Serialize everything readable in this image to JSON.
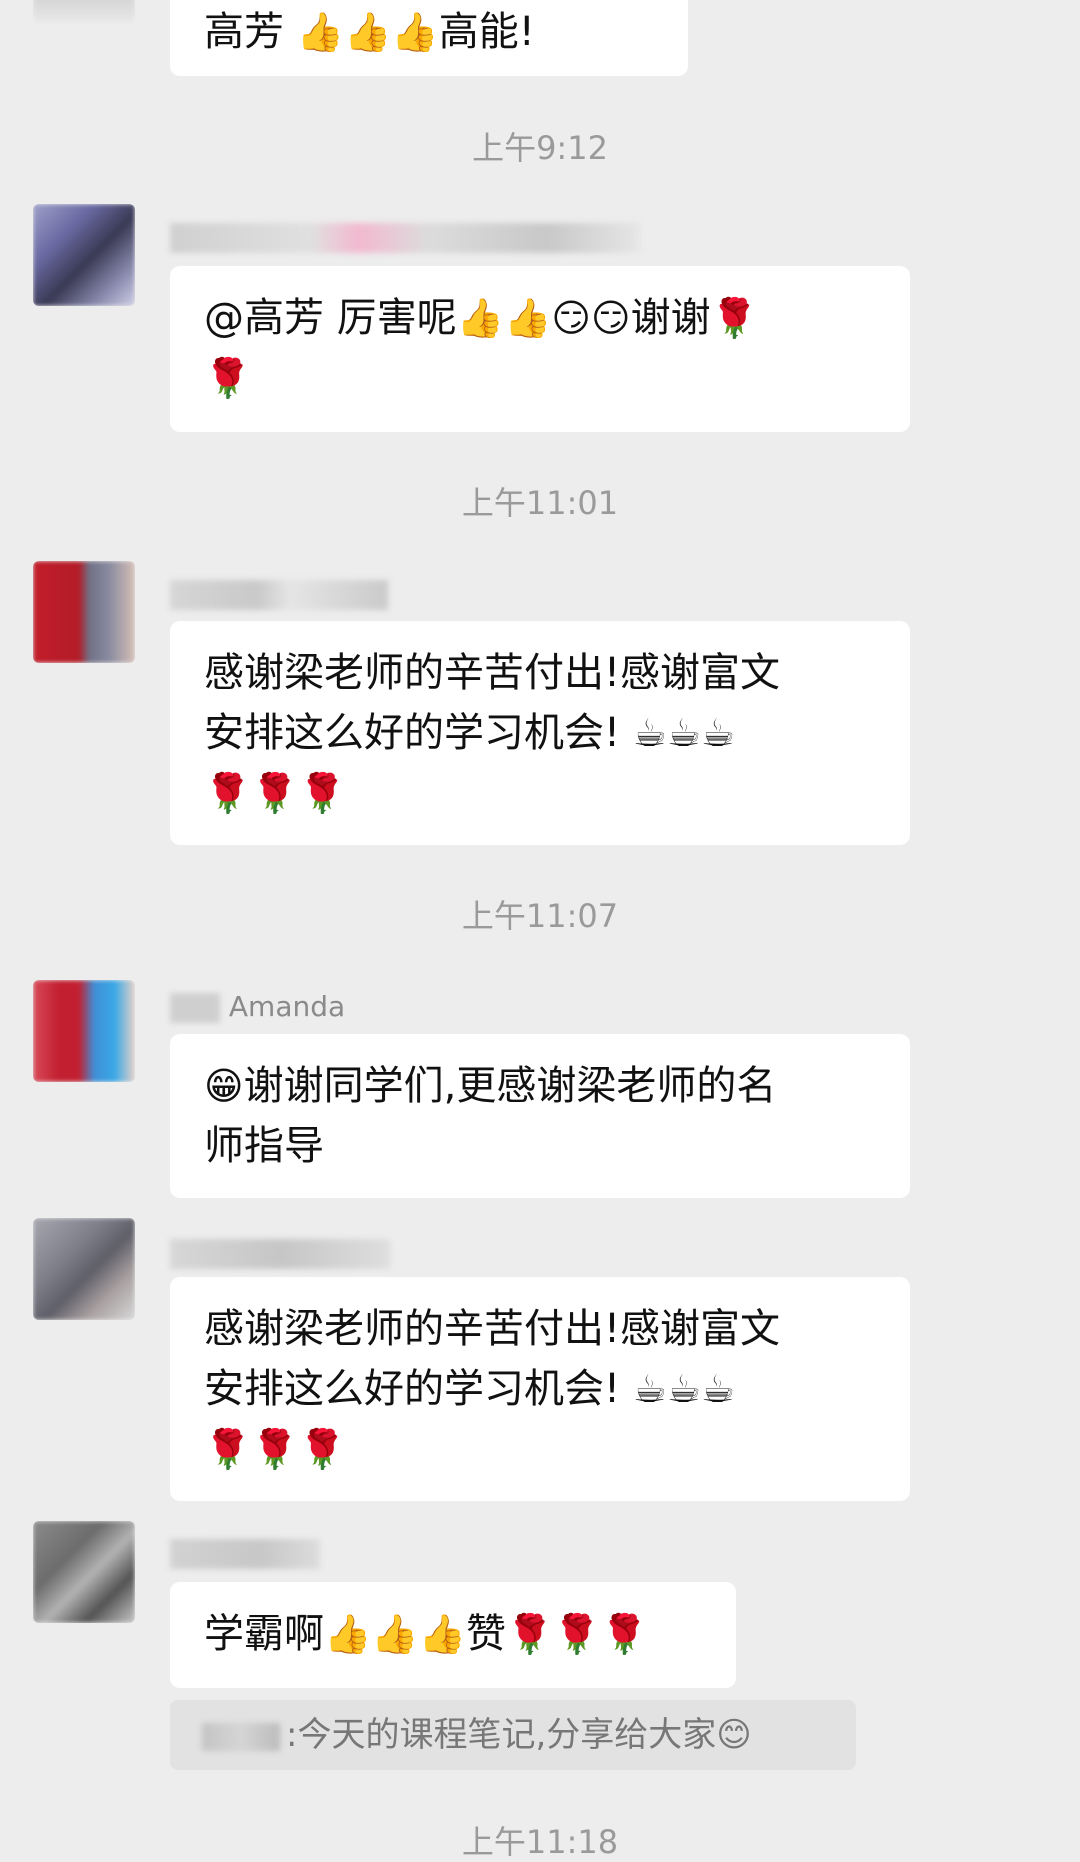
{
  "chat": {
    "messages": [
      {
        "type": "message",
        "name_text": "",
        "lines": [
          [
            {
              "t": "text",
              "v": "高芳 "
            },
            {
              "t": "emoji",
              "v": "👍"
            },
            {
              "t": "emoji",
              "v": "👍"
            },
            {
              "t": "emoji",
              "v": "👍"
            },
            {
              "t": "text",
              "v": "高能!"
            }
          ]
        ]
      },
      {
        "type": "time",
        "text": "上午9:12"
      },
      {
        "type": "message",
        "name_text": "",
        "lines": [
          [
            {
              "t": "text",
              "v": "@高芳 厉害呢"
            },
            {
              "t": "emoji",
              "v": "👍"
            },
            {
              "t": "emoji",
              "v": "👍"
            },
            {
              "t": "emoji",
              "v": "😏"
            },
            {
              "t": "emoji",
              "v": "😏"
            },
            {
              "t": "text",
              "v": "谢谢"
            },
            {
              "t": "emoji",
              "v": "🌹"
            }
          ],
          [
            {
              "t": "emoji",
              "v": "🌹"
            }
          ]
        ]
      },
      {
        "type": "time",
        "text": "上午11:01"
      },
      {
        "type": "message",
        "name_text": "",
        "lines": [
          [
            {
              "t": "text",
              "v": "感谢梁老师的辛苦付出!感谢富文"
            }
          ],
          [
            {
              "t": "text",
              "v": "安排这么好的学习机会! "
            },
            {
              "t": "emoji",
              "v": "☕"
            },
            {
              "t": "emoji",
              "v": "☕"
            },
            {
              "t": "emoji",
              "v": "☕"
            }
          ],
          [
            {
              "t": "emoji",
              "v": "🌹"
            },
            {
              "t": "emoji",
              "v": "🌹"
            },
            {
              "t": "emoji",
              "v": "🌹"
            }
          ]
        ]
      },
      {
        "type": "time",
        "text": "上午11:07"
      },
      {
        "type": "message",
        "name_text": "Amanda",
        "lines": [
          [
            {
              "t": "emoji",
              "v": "😁"
            },
            {
              "t": "text",
              "v": "谢谢同学们,更感谢梁老师的名"
            }
          ],
          [
            {
              "t": "text",
              "v": "师指导"
            }
          ]
        ]
      },
      {
        "type": "message",
        "name_text": "",
        "lines": [
          [
            {
              "t": "text",
              "v": "感谢梁老师的辛苦付出!感谢富文"
            }
          ],
          [
            {
              "t": "text",
              "v": "安排这么好的学习机会! "
            },
            {
              "t": "emoji",
              "v": "☕"
            },
            {
              "t": "emoji",
              "v": "☕"
            },
            {
              "t": "emoji",
              "v": "☕"
            }
          ],
          [
            {
              "t": "emoji",
              "v": "🌹"
            },
            {
              "t": "emoji",
              "v": "🌹"
            },
            {
              "t": "emoji",
              "v": "🌹"
            }
          ]
        ]
      },
      {
        "type": "message",
        "name_text": "",
        "lines": [
          [
            {
              "t": "text",
              "v": "学霸啊"
            },
            {
              "t": "emoji",
              "v": "👍"
            },
            {
              "t": "emoji",
              "v": "👍"
            },
            {
              "t": "emoji",
              "v": "👍"
            },
            {
              "t": "text",
              "v": "赞"
            },
            {
              "t": "emoji",
              "v": "🌹"
            },
            {
              "t": "emoji",
              "v": "🌹"
            },
            {
              "t": "emoji",
              "v": "🌹"
            }
          ]
        ]
      },
      {
        "type": "quote",
        "text": ":今天的课程笔记,分享给大家",
        "emoji": "😊"
      },
      {
        "type": "time",
        "text": "上午11:18"
      }
    ]
  },
  "colors": {
    "background": "#ededed",
    "bubble": "#ffffff",
    "time_text": "#9a9a9a",
    "name_text": "#8a8a8a",
    "quote_bg": "#e2e2e2"
  }
}
